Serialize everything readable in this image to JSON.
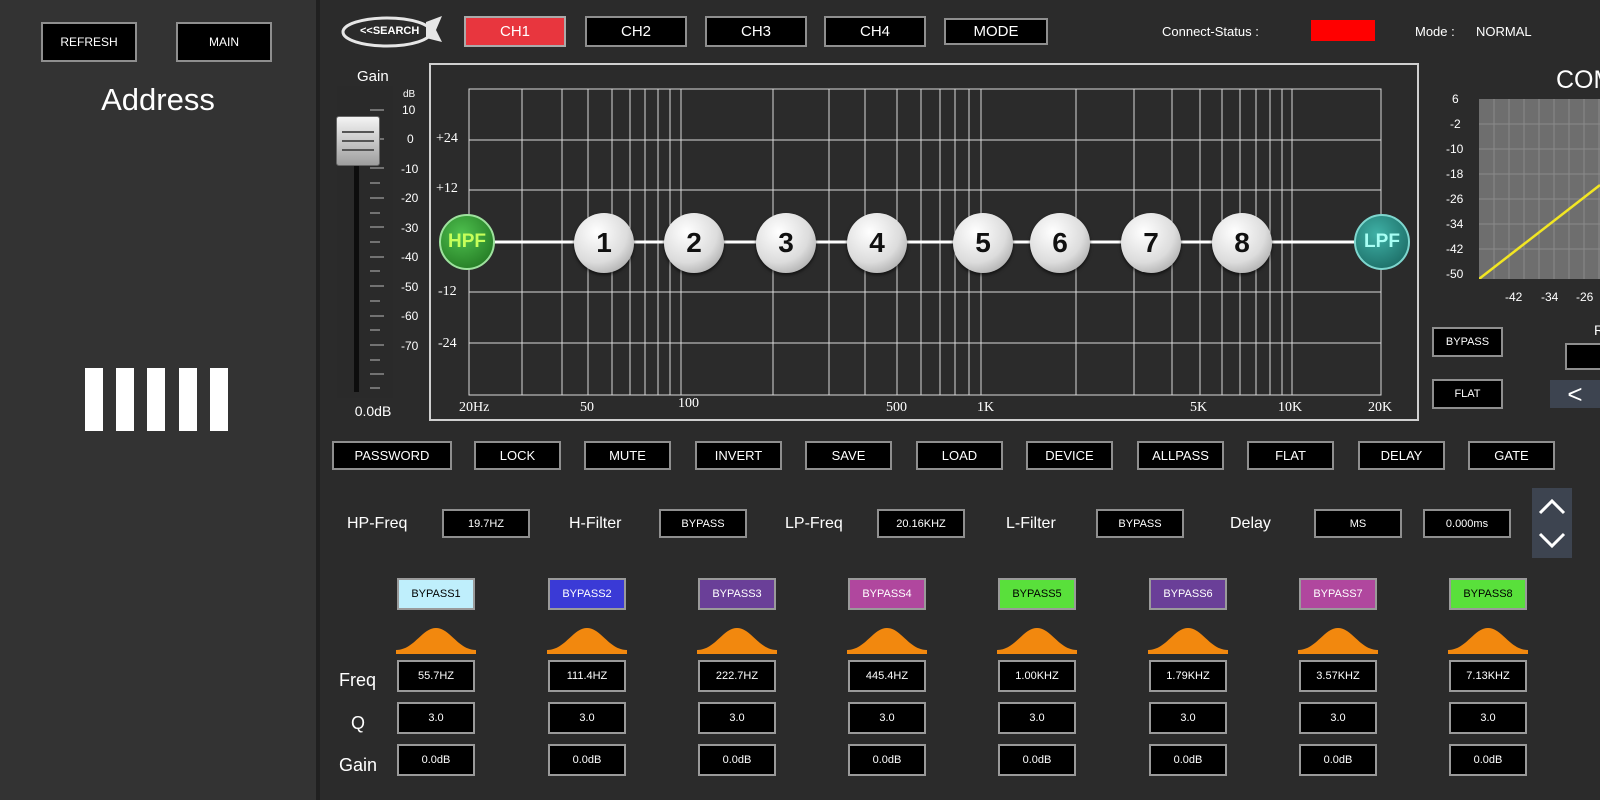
{
  "left_panel": {
    "refresh_label": "REFRESH",
    "main_label": "MAIN",
    "address_title": "Address"
  },
  "top_bar": {
    "search_label": "<<SEARCH",
    "channels": [
      {
        "label": "CH1",
        "active": true
      },
      {
        "label": "CH2",
        "active": false
      },
      {
        "label": "CH3",
        "active": false
      },
      {
        "label": "CH4",
        "active": false
      }
    ],
    "mode_button": "MODE",
    "connect_status_label": "Connect-Status :",
    "connect_status_color": "#ff0000",
    "mode_label": "Mode :",
    "mode_value": "NORMAL"
  },
  "gain_fader": {
    "title": "Gain",
    "unit": "dB",
    "scale": [
      "10",
      "0",
      "-10",
      "-20",
      "-30",
      "-40",
      "-50",
      "-60",
      "-70"
    ],
    "value_label": "0.0dB"
  },
  "eq_graph": {
    "y_labels": [
      "+24",
      "+12",
      "-12",
      "-24"
    ],
    "x_labels": [
      "20Hz",
      "50",
      "100",
      "500",
      "1K",
      "5K",
      "10K",
      "20K"
    ],
    "hpf_label": "HPF",
    "lpf_label": "LPF",
    "bands": [
      "1",
      "2",
      "3",
      "4",
      "5",
      "6",
      "7",
      "8"
    ]
  },
  "compressor": {
    "title": "COM",
    "y_labels": [
      "6",
      "-2",
      "-10",
      "-18",
      "-26",
      "-34",
      "-42",
      "-50"
    ],
    "x_labels": [
      "-42",
      "-34",
      "-26"
    ],
    "bypass_label": "BYPASS",
    "flat_label": "FLAT",
    "partial_label": "R",
    "prev_icon": "chevron-left-icon"
  },
  "toolbar": [
    "PASSWORD",
    "LOCK",
    "MUTE",
    "INVERT",
    "SAVE",
    "LOAD",
    "DEVICE",
    "ALLPASS",
    "FLAT",
    "DELAY",
    "GATE"
  ],
  "filters": {
    "hp_freq_label": "HP-Freq",
    "hp_freq_value": "19.7HZ",
    "h_filter_label": "H-Filter",
    "h_filter_value": "BYPASS",
    "lp_freq_label": "LP-Freq",
    "lp_freq_value": "20.16KHZ",
    "l_filter_label": "L-Filter",
    "l_filter_value": "BYPASS",
    "delay_label": "Delay",
    "delay_unit": "MS",
    "delay_value": "0.000ms"
  },
  "band_table": {
    "freq_label": "Freq",
    "q_label": "Q",
    "gain_label": "Gain",
    "bands": [
      {
        "bypass": "BYPASS1",
        "color": "#bfeffc",
        "text_color": "#000000",
        "freq": "55.7HZ",
        "q": "3.0",
        "gain": "0.0dB"
      },
      {
        "bypass": "BYPASS2",
        "color": "#3a3ad6",
        "text_color": "#ffffff",
        "freq": "111.4HZ",
        "q": "3.0",
        "gain": "0.0dB"
      },
      {
        "bypass": "BYPASS3",
        "color": "#6a3f98",
        "text_color": "#ffffff",
        "freq": "222.7HZ",
        "q": "3.0",
        "gain": "0.0dB"
      },
      {
        "bypass": "BYPASS4",
        "color": "#b0479e",
        "text_color": "#ffffff",
        "freq": "445.4HZ",
        "q": "3.0",
        "gain": "0.0dB"
      },
      {
        "bypass": "BYPASS5",
        "color": "#59e03b",
        "text_color": "#000000",
        "freq": "1.00KHZ",
        "q": "3.0",
        "gain": "0.0dB"
      },
      {
        "bypass": "BYPASS6",
        "color": "#6a3f98",
        "text_color": "#ffffff",
        "freq": "1.79KHZ",
        "q": "3.0",
        "gain": "0.0dB"
      },
      {
        "bypass": "BYPASS7",
        "color": "#b0479e",
        "text_color": "#ffffff",
        "freq": "3.57KHZ",
        "q": "3.0",
        "gain": "0.0dB"
      },
      {
        "bypass": "BYPASS8",
        "color": "#59e03b",
        "text_color": "#000000",
        "freq": "7.13KHZ",
        "q": "3.0",
        "gain": "0.0dB"
      }
    ]
  }
}
